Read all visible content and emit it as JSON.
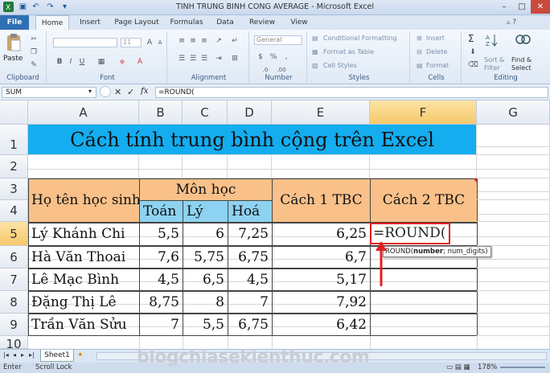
{
  "window": {
    "title": "TINH TRUNG BINH CONG AVERAGE - Microsoft Excel"
  },
  "tabs": [
    "File",
    "Home",
    "Insert",
    "Page Layout",
    "Formulas",
    "Data",
    "Review",
    "View"
  ],
  "ribbon": {
    "clipboard": {
      "label": "Clipboard",
      "paste": "Paste"
    },
    "font": {
      "label": "Font",
      "size": "11"
    },
    "alignment": {
      "label": "Alignment"
    },
    "number": {
      "label": "Number",
      "format": "General"
    },
    "styles": {
      "label": "Styles",
      "conditional": "Conditional Formatting",
      "table": "Format as Table",
      "cell_styles": "Cell Styles"
    },
    "cells": {
      "label": "Cells",
      "insert": "Insert",
      "delete": "Delete",
      "format": "Format"
    },
    "editing": {
      "label": "Editing",
      "sum": "Σ",
      "sort": "Sort &",
      "filter": "Filter",
      "find": "Find &",
      "select": "Select"
    }
  },
  "formula_bar": {
    "name_box": "SUM",
    "fx": "fx",
    "formula": "=ROUND("
  },
  "columns": [
    "A",
    "B",
    "C",
    "D",
    "E",
    "F",
    "G"
  ],
  "rows": [
    "1",
    "2",
    "3",
    "4",
    "5",
    "6",
    "7",
    "8",
    "9",
    "10"
  ],
  "sheet": {
    "title": "Cách tính trung bình cộng trên Excel",
    "header_name": "Họ tên học sinh",
    "header_subjects": "Môn học",
    "subjects": [
      "Toán",
      "Lý",
      "Hoá"
    ],
    "header_c1": "Cách 1 TBC",
    "header_c2": "Cách 2 TBC",
    "students": [
      {
        "name": "Lý Khánh Chi",
        "toan": "5,5",
        "ly": "6",
        "hoa": "7,25",
        "tbc1": "6,25"
      },
      {
        "name": "Hà Văn Thoai",
        "toan": "7,6",
        "ly": "5,75",
        "hoa": "6,75",
        "tbc1": "6,7"
      },
      {
        "name": "Lê Mạc Bình",
        "toan": "4,5",
        "ly": "6,5",
        "hoa": "4,5",
        "tbc1": "5,17"
      },
      {
        "name": "Đặng Thị Lê",
        "toan": "8,75",
        "ly": "8",
        "hoa": "7",
        "tbc1": "7,92"
      },
      {
        "name": "Trần Văn Sửu",
        "toan": "7",
        "ly": "5,5",
        "hoa": "6,75",
        "tbc1": "6,42"
      }
    ],
    "editing_cell": "=ROUND(",
    "tooltip_fn": "ROUND(",
    "tooltip_arg1": "number",
    "tooltip_rest": "; num_digits)"
  },
  "sheet_tabs": [
    "Sheet1"
  ],
  "status": {
    "mode": "Enter",
    "scroll_lock": "Scroll Lock",
    "zoom": "178%"
  },
  "watermark": "blogchiasekienthuc.com",
  "colors": {
    "title_fill": "#14adf0",
    "header_fill": "#f9c089",
    "subject_fill": "#8ed2f1",
    "highlight": "#e02020"
  }
}
